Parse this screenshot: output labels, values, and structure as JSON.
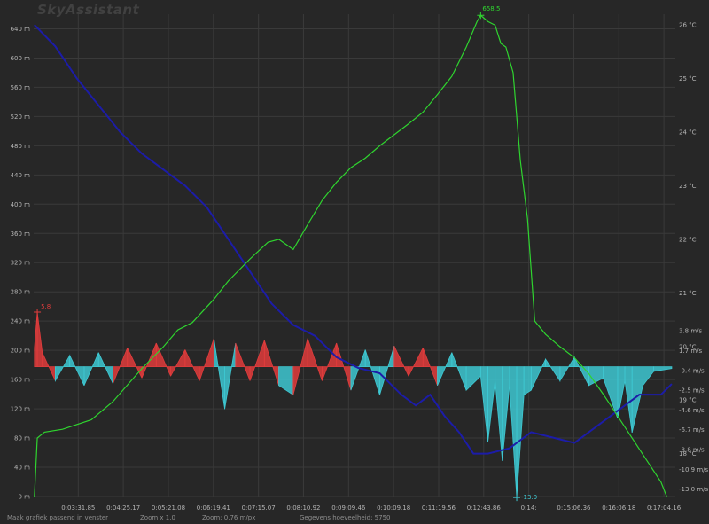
{
  "app": {
    "title": "SkyAssistant"
  },
  "status_bar": {
    "fit_label": "Maak grafiek passend in venster",
    "zoom_label": "Zoom x 1.0",
    "zoom_rate": "Zoom: 0.76 m/px",
    "data_count": "Gegevens hoeveelheid: 5750"
  },
  "colors": {
    "background": "#272727",
    "grid": "#3a3a3a",
    "altitude": "#2fd42f",
    "temperature": "#1c1ca8",
    "climb": "#e03c3c",
    "sink": "#3ec8d2",
    "axis_text": "#b4b4b4"
  },
  "chart_data": [
    {
      "type": "line",
      "name": "altitude",
      "axis": "left",
      "ylim": [
        0,
        660
      ],
      "yticks": [
        "0 m",
        "40 m",
        "80 m",
        "120 m",
        "160 m",
        "200 m",
        "240 m",
        "280 m",
        "320 m",
        "360 m",
        "400 m",
        "440 m",
        "480 m",
        "520 m",
        "560 m",
        "600 m",
        "640 m"
      ],
      "x_ticks": [
        "0:03:31.85",
        "0:04:25.17",
        "0:05:21.08",
        "0:06:19.41",
        "0:07:15.07",
        "0:08:10.92",
        "0:09:09.46",
        "0:10:09.18",
        "0:11:19.56",
        "0:12:43.86",
        "0:14:",
        "0:15:06.36",
        "0:16:06.18",
        "0:17:04.16"
      ],
      "x_range": [
        "0:02:30",
        "0:17:20"
      ],
      "peak_label": "658.5",
      "points": [
        [
          "0:02:31",
          0
        ],
        [
          "0:02:35",
          80
        ],
        [
          "0:02:45",
          88
        ],
        [
          "0:03:10",
          92
        ],
        [
          "0:03:50",
          105
        ],
        [
          "0:04:20",
          130
        ],
        [
          "0:05:00",
          175
        ],
        [
          "0:05:30",
          205
        ],
        [
          "0:05:50",
          228
        ],
        [
          "0:06:10",
          238
        ],
        [
          "0:06:40",
          270
        ],
        [
          "0:07:00",
          295
        ],
        [
          "0:07:30",
          325
        ],
        [
          "0:07:55",
          348
        ],
        [
          "0:08:10",
          352
        ],
        [
          "0:08:30",
          338
        ],
        [
          "0:08:50",
          372
        ],
        [
          "0:09:10",
          405
        ],
        [
          "0:09:30",
          430
        ],
        [
          "0:09:50",
          450
        ],
        [
          "0:10:10",
          463
        ],
        [
          "0:10:30",
          480
        ],
        [
          "0:10:50",
          495
        ],
        [
          "0:11:10",
          510
        ],
        [
          "0:11:30",
          526
        ],
        [
          "0:11:50",
          550
        ],
        [
          "0:12:10",
          575
        ],
        [
          "0:12:30",
          615
        ],
        [
          "0:12:45",
          650
        ],
        [
          "0:12:50",
          658.5
        ],
        [
          "0:13:00",
          650
        ],
        [
          "0:13:10",
          645
        ],
        [
          "0:13:18",
          620
        ],
        [
          "0:13:25",
          615
        ],
        [
          "0:13:35",
          580
        ],
        [
          "0:13:45",
          460
        ],
        [
          "0:13:55",
          380
        ],
        [
          "0:14:05",
          240
        ],
        [
          "0:14:20",
          222
        ],
        [
          "0:14:40",
          205
        ],
        [
          "0:15:00",
          190
        ],
        [
          "0:15:20",
          168
        ],
        [
          "0:15:40",
          140
        ],
        [
          "0:16:00",
          110
        ],
        [
          "0:16:20",
          80
        ],
        [
          "0:16:40",
          50
        ],
        [
          "0:17:00",
          20
        ],
        [
          "0:17:08",
          0
        ]
      ]
    },
    {
      "type": "line",
      "name": "temperature",
      "axis": "right",
      "ylim": [
        17.2,
        26.2
      ],
      "yticks": [
        "18 °C",
        "19 °C",
        "20 °C",
        "21 °C",
        "22 °C",
        "23 °C",
        "24 °C",
        "25 °C",
        "26 °C"
      ],
      "points": [
        [
          "0:02:31",
          26.0
        ],
        [
          "0:03:00",
          25.6
        ],
        [
          "0:03:30",
          25.0
        ],
        [
          "0:04:00",
          24.5
        ],
        [
          "0:04:30",
          24.0
        ],
        [
          "0:05:00",
          23.6
        ],
        [
          "0:05:30",
          23.3
        ],
        [
          "0:06:00",
          23.0
        ],
        [
          "0:06:30",
          22.6
        ],
        [
          "0:07:00",
          22.0
        ],
        [
          "0:07:30",
          21.4
        ],
        [
          "0:08:00",
          20.8
        ],
        [
          "0:08:30",
          20.4
        ],
        [
          "0:09:00",
          20.2
        ],
        [
          "0:09:30",
          19.8
        ],
        [
          "0:10:00",
          19.6
        ],
        [
          "0:10:30",
          19.5
        ],
        [
          "0:11:00",
          19.1
        ],
        [
          "0:11:20",
          18.9
        ],
        [
          "0:11:40",
          19.1
        ],
        [
          "0:12:00",
          18.7
        ],
        [
          "0:12:20",
          18.4
        ],
        [
          "0:12:40",
          18.0
        ],
        [
          "0:13:00",
          18.0
        ],
        [
          "0:13:30",
          18.1
        ],
        [
          "0:14:00",
          18.4
        ],
        [
          "0:14:30",
          18.3
        ],
        [
          "0:15:00",
          18.2
        ],
        [
          "0:15:30",
          18.5
        ],
        [
          "0:16:00",
          18.8
        ],
        [
          "0:16:30",
          19.1
        ],
        [
          "0:17:00",
          19.1
        ],
        [
          "0:17:15",
          19.3
        ]
      ]
    },
    {
      "type": "area",
      "name": "vario",
      "axis": "right",
      "ylim": [
        -13.6,
        5.8
      ],
      "yticks": [
        "3.8 m/s",
        "1.7 m/s",
        "-0.4 m/s",
        "-2.5 m/s",
        "-4.6 m/s",
        "-6.7 m/s",
        "-8.8 m/s",
        "-10.9 m/s",
        "-13.0 m/s"
      ],
      "max_label": "5.8",
      "min_label": "-13.9",
      "points": [
        [
          "0:02:31",
          2.0
        ],
        [
          "0:02:35",
          5.8
        ],
        [
          "0:02:42",
          1.5
        ],
        [
          "0:03:00",
          -1.5
        ],
        [
          "0:03:20",
          1.2
        ],
        [
          "0:03:40",
          -2.0
        ],
        [
          "0:04:00",
          1.5
        ],
        [
          "0:04:20",
          -1.8
        ],
        [
          "0:04:40",
          2.0
        ],
        [
          "0:05:00",
          -1.2
        ],
        [
          "0:05:20",
          2.5
        ],
        [
          "0:05:40",
          -1.0
        ],
        [
          "0:06:00",
          1.8
        ],
        [
          "0:06:20",
          -1.5
        ],
        [
          "0:06:40",
          3.0
        ],
        [
          "0:06:55",
          -4.5
        ],
        [
          "0:07:10",
          2.5
        ],
        [
          "0:07:30",
          -1.5
        ],
        [
          "0:07:50",
          2.8
        ],
        [
          "0:08:10",
          -2.0
        ],
        [
          "0:08:30",
          -3.0
        ],
        [
          "0:08:50",
          3.0
        ],
        [
          "0:09:10",
          -1.5
        ],
        [
          "0:09:30",
          2.5
        ],
        [
          "0:09:50",
          -2.5
        ],
        [
          "0:10:10",
          1.8
        ],
        [
          "0:10:30",
          -3.0
        ],
        [
          "0:10:50",
          2.2
        ],
        [
          "0:11:10",
          -1.0
        ],
        [
          "0:11:30",
          2.0
        ],
        [
          "0:11:50",
          -2.0
        ],
        [
          "0:12:10",
          1.5
        ],
        [
          "0:12:30",
          -2.5
        ],
        [
          "0:12:50",
          -1.0
        ],
        [
          "0:13:00",
          -8.0
        ],
        [
          "0:13:10",
          -1.5
        ],
        [
          "0:13:20",
          -10.0
        ],
        [
          "0:13:30",
          -2.0
        ],
        [
          "0:13:40",
          -13.9
        ],
        [
          "0:13:50",
          -3.0
        ],
        [
          "0:14:00",
          -2.5
        ],
        [
          "0:14:20",
          0.8
        ],
        [
          "0:14:40",
          -1.5
        ],
        [
          "0:15:00",
          1.0
        ],
        [
          "0:15:20",
          -2.0
        ],
        [
          "0:15:40",
          -1.2
        ],
        [
          "0:16:00",
          -5.5
        ],
        [
          "0:16:10",
          -1.5
        ],
        [
          "0:16:20",
          -7.0
        ],
        [
          "0:16:35",
          -2.0
        ],
        [
          "0:16:50",
          -0.5
        ],
        [
          "0:17:15",
          -0.2
        ]
      ]
    }
  ]
}
